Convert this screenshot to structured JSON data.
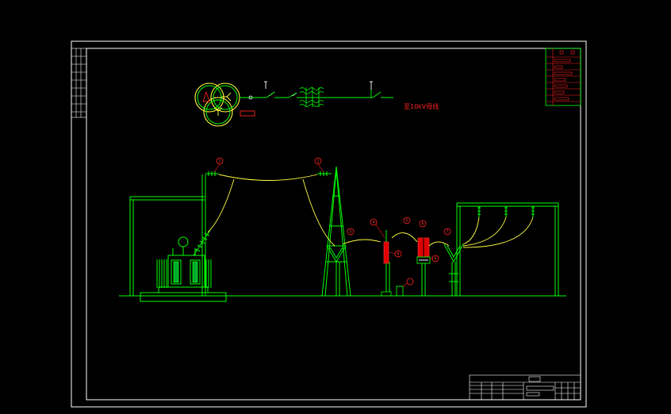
{
  "diagram": {
    "bus_label": "至10kV母线",
    "balloons": [
      "1",
      "2",
      "3",
      "4",
      "5",
      "6",
      "7",
      "8",
      "9"
    ]
  },
  "colors": {
    "background": "#000000",
    "frame": "#ffffff",
    "equipment": "#00ff00",
    "conductor": "#ffff40",
    "annotation": "#ff2020",
    "highlight": "#ff0000"
  }
}
